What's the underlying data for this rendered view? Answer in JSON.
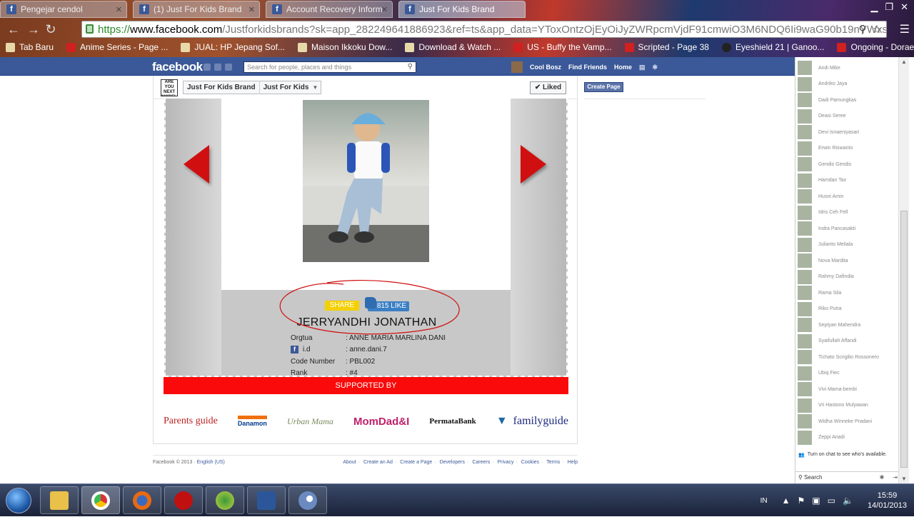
{
  "browser": {
    "tabs": [
      {
        "title": "Pengejar cendol",
        "icon": "f"
      },
      {
        "title": "(1) Just For Kids Brand",
        "icon": "f"
      },
      {
        "title": "Account Recovery Inform",
        "icon": "f"
      },
      {
        "title": "Just For Kids Brand",
        "icon": "f"
      }
    ],
    "url_https": "https://",
    "url_host": "www.facebook.com",
    "url_rest": "/Justforkidsbrands?sk=app_282249641886923&ref=ts&app_data=YToxOntzOjEyOiJyZWRpcmVjdF91cmwiO3M6NDQ6Ii9waG90b19nYWxsZXJ5L2l",
    "bookmarks": [
      "Tab Baru",
      "Anime Series - Page ...",
      "JUAL: HP Jepang Sof...",
      "Maison Ikkoku Dow...",
      "Download & Watch ...",
      "US - Buffy the Vamp...",
      "Scripted - Page 38",
      "Eyeshield 21 | Ganoo...",
      "Ongoing - Doraemo..."
    ]
  },
  "facebook": {
    "logo": "facebook",
    "search_placeholder": "Search for people, places and things",
    "user_name": "Cool Bosz",
    "find_friends": "Find Friends",
    "home": "Home",
    "page_logo_text": "ARE YOU NEXT MODEL?",
    "crumb_page": "Just For Kids Brand",
    "crumb_app": "Just For Kids",
    "liked_label": "✔ Liked",
    "create_page": "Create Page"
  },
  "app": {
    "share_label": "SHARE",
    "like_label": "815 LIKE",
    "name": "JERRYANDHI JONATHAN",
    "info": [
      {
        "key": "Orgtua",
        "value": ": ANNE MARIA MARLINA DANI"
      },
      {
        "key": "i.d",
        "value": ": anne.dani.7"
      },
      {
        "key": "Code Number",
        "value": ": PBL002"
      },
      {
        "key": "Rank",
        "value": ": #4"
      }
    ],
    "supported_by": "SUPPORTED BY",
    "sponsors": [
      "Parents guide",
      "Danamon",
      "Urban Mama",
      "MomDad&I",
      "PermataBank",
      "familyguide"
    ]
  },
  "footer": {
    "copyright": "Facebook © 2013 ·",
    "language": "English (US)",
    "links": [
      "About",
      "Create an Ad",
      "Create a Page",
      "Developers",
      "Careers",
      "Privacy",
      "Cookies",
      "Terms",
      "Help"
    ]
  },
  "chat": {
    "friends": [
      "Andi Mike",
      "Andriko Jaya",
      "Dadi Pamungkas",
      "Deasi Seree",
      "Devi Isnaeniyasari",
      "Erwin Riswanto",
      "Gendis Gendis",
      "Hamdan Tax",
      "Husni Amin",
      "Idris Ceh Fell",
      "Indra Pancasakti",
      "Julianto Meliala",
      "Nova Mardita",
      "Rahmy Dafindia",
      "Rama Sila",
      "Riko Putra",
      "Septyan Mahendra",
      "Syaifullah Affandi",
      "Tichato Scrigilio Rossonero",
      "Ubiq Fiec",
      "Vivi Mama-bembi",
      "Vri Hastono Mulyawan",
      "Widha Winneke Pradani",
      "Zeppi Ariadi"
    ],
    "notice": "Turn on chat to see who's available.",
    "search_label": "Search"
  },
  "taskbar": {
    "lang": "IN",
    "time": "15:59",
    "date": "14/01/2013"
  },
  "colors": {
    "fb_blue": "#3b5998",
    "supported_red": "#fa0a0a",
    "arrow_red": "#d01010",
    "share_yellow": "#f5d000",
    "like_blue": "#3b7fc4"
  }
}
